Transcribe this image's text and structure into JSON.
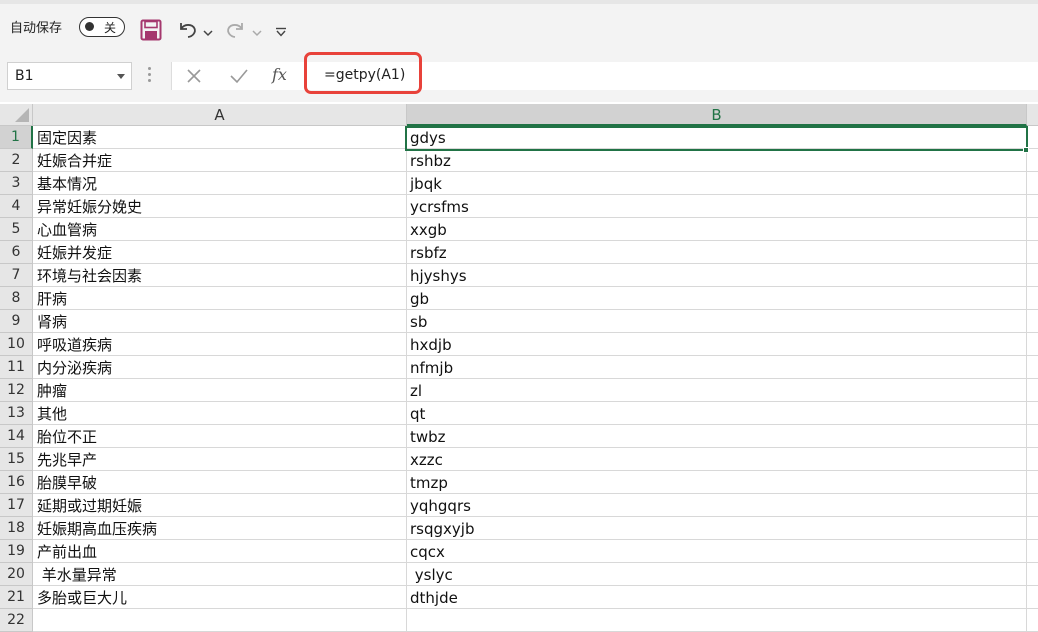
{
  "quick_access": {
    "autosave_label": "自动保存",
    "autosave_state": "关",
    "icons": [
      "save-icon",
      "undo-icon",
      "redo-icon",
      "customize-icon"
    ],
    "accent_color": "#a4376d"
  },
  "formula_bar": {
    "name_box": "B1",
    "fx_label": "fx",
    "formula": "=getpy(A1)",
    "highlight_color": "#e8423a"
  },
  "sheet": {
    "columns": [
      "A",
      "B"
    ],
    "selected_column": "B",
    "selected_row": "1",
    "active_cell_color": "#217346",
    "rows": [
      {
        "num": "1",
        "a": "固定因素",
        "b": "gdys"
      },
      {
        "num": "2",
        "a": "妊娠合并症",
        "b": "rshbz"
      },
      {
        "num": "3",
        "a": "基本情况",
        "b": "jbqk"
      },
      {
        "num": "4",
        "a": "异常妊娠分娩史",
        "b": "ycrsfms"
      },
      {
        "num": "5",
        "a": "心血管病",
        "b": "xxgb"
      },
      {
        "num": "6",
        "a": "妊娠并发症",
        "b": "rsbfz"
      },
      {
        "num": "7",
        "a": "环境与社会因素",
        "b": "hjyshys"
      },
      {
        "num": "8",
        "a": "肝病",
        "b": "gb"
      },
      {
        "num": "9",
        "a": "肾病",
        "b": "sb"
      },
      {
        "num": "10",
        "a": "呼吸道疾病",
        "b": "hxdjb"
      },
      {
        "num": "11",
        "a": "内分泌疾病",
        "b": "nfmjb"
      },
      {
        "num": "12",
        "a": "肿瘤",
        "b": "zl"
      },
      {
        "num": "13",
        "a": "其他",
        "b": "qt"
      },
      {
        "num": "14",
        "a": "胎位不正",
        "b": "twbz"
      },
      {
        "num": "15",
        "a": "先兆早产",
        "b": "xzzc"
      },
      {
        "num": "16",
        "a": "胎膜早破",
        "b": "tmzp"
      },
      {
        "num": "17",
        "a": "延期或过期妊娠",
        "b": "yqhgqrs"
      },
      {
        "num": "18",
        "a": "妊娠期高血压疾病",
        "b": "rsqgxyjb"
      },
      {
        "num": "19",
        "a": "产前出血",
        "b": "cqcx"
      },
      {
        "num": "20",
        "a": " 羊水量异常",
        "b": " yslyc"
      },
      {
        "num": "21",
        "a": "多胎或巨大儿",
        "b": "dthjde"
      },
      {
        "num": "22",
        "a": "",
        "b": ""
      }
    ]
  }
}
